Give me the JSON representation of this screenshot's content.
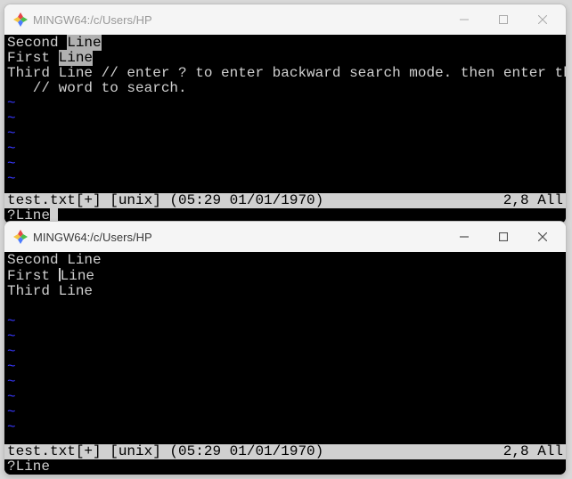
{
  "window1": {
    "title": "MINGW64:/c/Users/HP",
    "lines": {
      "l1a": "Second ",
      "l1b": "Line",
      "l2a": "First ",
      "l2b": "Line",
      "l3": "Third Line // enter ? to enter backward search mode. then enter the",
      "l4": "   // word to search."
    },
    "status_left": "test.txt[+] [unix] (05:29 01/01/1970)",
    "status_right": "2,8 All",
    "cmd_prefix": "?Line"
  },
  "window2": {
    "title": "MINGW64:/c/Users/HP",
    "lines": {
      "l1": "Second Line",
      "l2a": "First ",
      "l2b": "Line",
      "l3": "Third Line"
    },
    "status_left": "test.txt[+] [unix] (05:29 01/01/1970)",
    "status_right": "2,8 All",
    "cmd": "?Line"
  },
  "tilde": "~"
}
